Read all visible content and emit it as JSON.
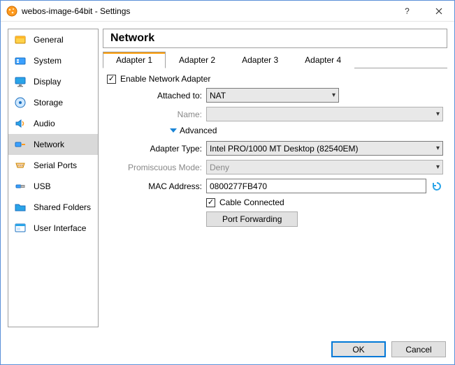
{
  "window": {
    "title": "webos-image-64bit - Settings"
  },
  "sidebar": {
    "items": [
      {
        "label": "General"
      },
      {
        "label": "System"
      },
      {
        "label": "Display"
      },
      {
        "label": "Storage"
      },
      {
        "label": "Audio"
      },
      {
        "label": "Network"
      },
      {
        "label": "Serial Ports"
      },
      {
        "label": "USB"
      },
      {
        "label": "Shared Folders"
      },
      {
        "label": "User Interface"
      }
    ]
  },
  "main": {
    "heading": "Network",
    "tabs": [
      {
        "label": "Adapter 1"
      },
      {
        "label": "Adapter 2"
      },
      {
        "label": "Adapter 3"
      },
      {
        "label": "Adapter 4"
      }
    ],
    "enable_label": "Enable Network Adapter",
    "attached_to": {
      "label": "Attached to:",
      "value": "NAT"
    },
    "name": {
      "label": "Name:",
      "value": ""
    },
    "advanced_label": "Advanced",
    "adapter_type": {
      "label": "Adapter Type:",
      "value": "Intel PRO/1000 MT Desktop (82540EM)"
    },
    "promiscuous": {
      "label": "Promiscuous Mode:",
      "value": "Deny"
    },
    "mac": {
      "label": "MAC Address:",
      "value": "0800277FB470"
    },
    "cable_label": "Cable Connected",
    "port_fwd_label": "Port Forwarding"
  },
  "footer": {
    "ok": "OK",
    "cancel": "Cancel"
  }
}
